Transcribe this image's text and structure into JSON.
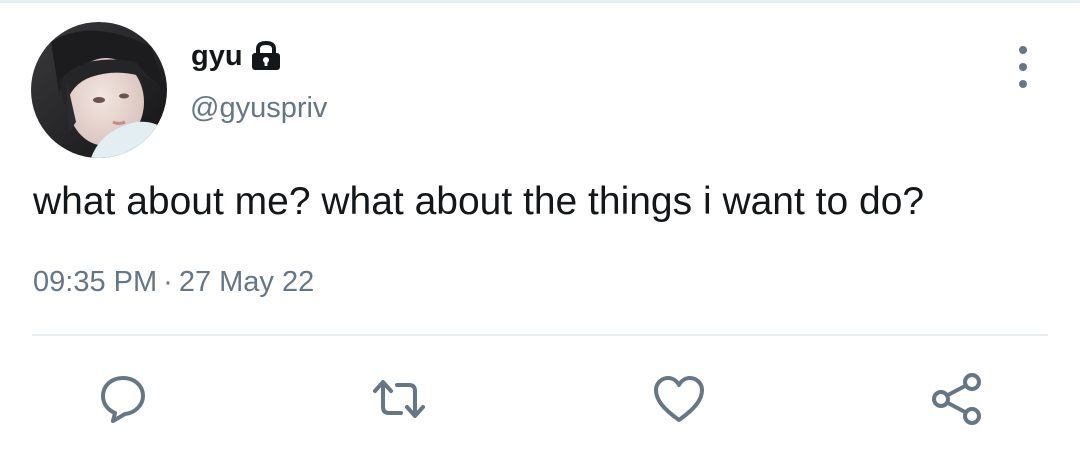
{
  "tweet": {
    "author": {
      "display_name": "gyu",
      "handle": "@gyuspriv",
      "protected_icon": "lock-icon",
      "avatar": "avatar"
    },
    "text": "what about me? what about the things i want to do?",
    "time": "09:35 PM",
    "separator": "·",
    "date": "27 May 22",
    "more_icon": "more-vertical-icon"
  },
  "actions": [
    {
      "name": "reply",
      "icon": "reply-icon"
    },
    {
      "name": "retweet",
      "icon": "retweet-icon"
    },
    {
      "name": "like",
      "icon": "heart-icon"
    },
    {
      "name": "share",
      "icon": "share-icon"
    }
  ],
  "colors": {
    "primary_text": "#14171a",
    "secondary_text": "#657786",
    "divider": "#e6ecf0",
    "background": "#ffffff"
  }
}
